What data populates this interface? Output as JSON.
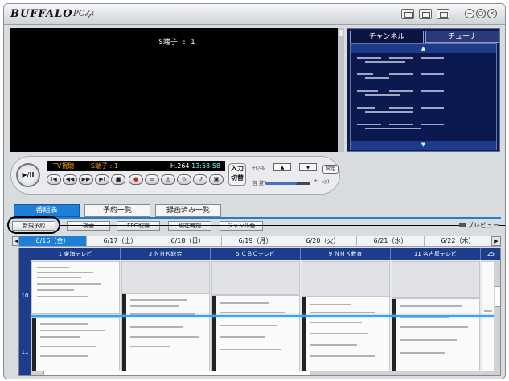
{
  "app": {
    "brand": "BUFFALO",
    "product": "PC𝒷𝓅",
    "window_buttons": [
      "minimize",
      "restore",
      "close"
    ]
  },
  "video": {
    "label": "S端子 : 1"
  },
  "channel_panel": {
    "tabs": [
      {
        "label": "チャンネル",
        "active": true
      },
      {
        "label": "チューナ",
        "active": false
      }
    ],
    "up_arrow": "▲",
    "down_arrow": "▼"
  },
  "controls": {
    "play_label": "▶/II",
    "lcd": {
      "mode": "TV視聴",
      "source": "S端子 : 1",
      "codec": "H.264",
      "time": "13:58:58"
    },
    "buttons": [
      "I◀",
      "◀◀",
      "▶▶",
      "▶I",
      "■",
      "●",
      "≡",
      "◎",
      "⊙",
      "↺",
      "▣"
    ],
    "input_switch": "入力\n切替",
    "channel_label": "ﾁｬﾝﾈﾙ",
    "channel_up": "▲",
    "channel_down": "▼",
    "settings": "設定",
    "volume_label": "音 量",
    "volume_level": 0.7,
    "volume_minus": "−",
    "volume_plus": "+",
    "speaker": "◁)))"
  },
  "view_tabs": [
    {
      "label": "番組表",
      "active": true
    },
    {
      "label": "予約一覧",
      "active": false
    },
    {
      "label": "録画済み一覧",
      "active": false
    }
  ],
  "toolbar": {
    "new_reservation": "新規予約",
    "search": "検索",
    "epg": "EPG取得",
    "current_time": "現在時刻",
    "genre": "ジャンル色",
    "preview": "プレビュー"
  },
  "dates": [
    {
      "label": "6/16（金）",
      "selected": true
    },
    {
      "label": "6/17（土）",
      "selected": false
    },
    {
      "label": "6/18（日）",
      "selected": false
    },
    {
      "label": "6/19（月）",
      "selected": false
    },
    {
      "label": "6/20（火）",
      "selected": false
    },
    {
      "label": "6/21（水）",
      "selected": false
    },
    {
      "label": "6/22（木）",
      "selected": false
    }
  ],
  "date_nav": {
    "prev": "◀",
    "next": "▶"
  },
  "stations": [
    "1 東海テレビ",
    "3 ＮＨＫ総合",
    "5 ＣＢＣテレビ",
    "9 ＮＨＫ教育",
    "11 名古屋テレビ",
    "25"
  ],
  "hours": [
    "10",
    "11"
  ]
}
